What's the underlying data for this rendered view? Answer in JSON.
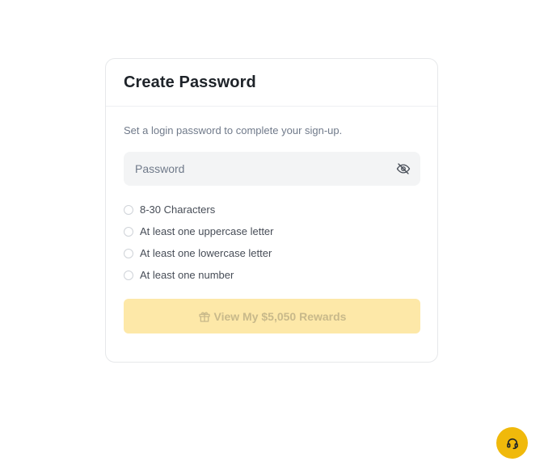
{
  "card": {
    "title": "Create Password",
    "subtitle": "Set a login password to complete your sign-up."
  },
  "password": {
    "placeholder": "Password",
    "value": "",
    "toggle_icon": "eye-off-icon"
  },
  "requirements": [
    {
      "label": "8-30 Characters",
      "met": false
    },
    {
      "label": "At least one uppercase letter",
      "met": false
    },
    {
      "label": "At least one lowercase letter",
      "met": false
    },
    {
      "label": "At least one number",
      "met": false
    }
  ],
  "reward_button": {
    "label": "View My $5,050 Rewards",
    "icon": "gift-icon",
    "disabled": true
  },
  "support": {
    "icon": "headset-icon"
  },
  "colors": {
    "accent": "#F0B90B",
    "button_disabled_bg": "#FDE8A8",
    "button_disabled_text": "#C8B98A",
    "title": "#1E2329",
    "muted": "#707A8A"
  }
}
